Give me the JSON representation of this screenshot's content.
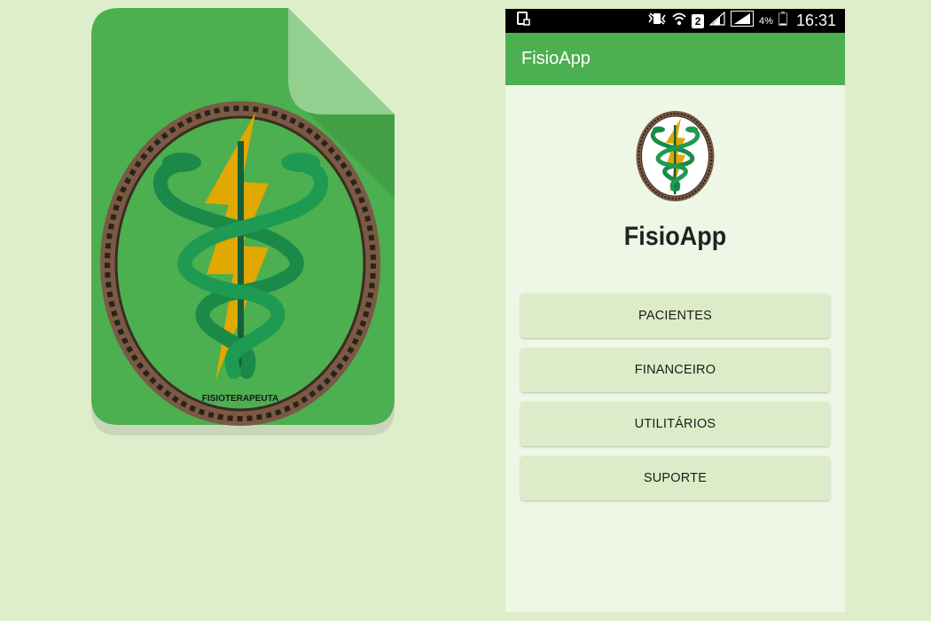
{
  "icon": {
    "seal_text": "FISIOTERAPEUTA",
    "colors": {
      "green": "#4caf50",
      "fold": "#93d08f",
      "snake": "#1b8a49",
      "bolt": "#e0a800"
    }
  },
  "status_bar": {
    "left_icons": [
      "screenshot-icon"
    ],
    "right_icons": [
      "vibrate-icon",
      "wifi-icon",
      "sim-icon",
      "signal-icon",
      "signal-icon",
      "battery-icon"
    ],
    "sim_number": "2",
    "battery": "4%",
    "time": "16:31"
  },
  "app_bar": {
    "title": "FisioApp"
  },
  "main": {
    "app_name": "FisioApp",
    "menu": [
      {
        "label": "PACIENTES"
      },
      {
        "label": "FINANCEIRO"
      },
      {
        "label": "UTILITÁRIOS"
      },
      {
        "label": "SUPORTE"
      }
    ]
  },
  "theme": {
    "primary": "#4caf50",
    "background": "#dfeeca",
    "screen": "#eef6e5",
    "button": "#ddecc8"
  }
}
